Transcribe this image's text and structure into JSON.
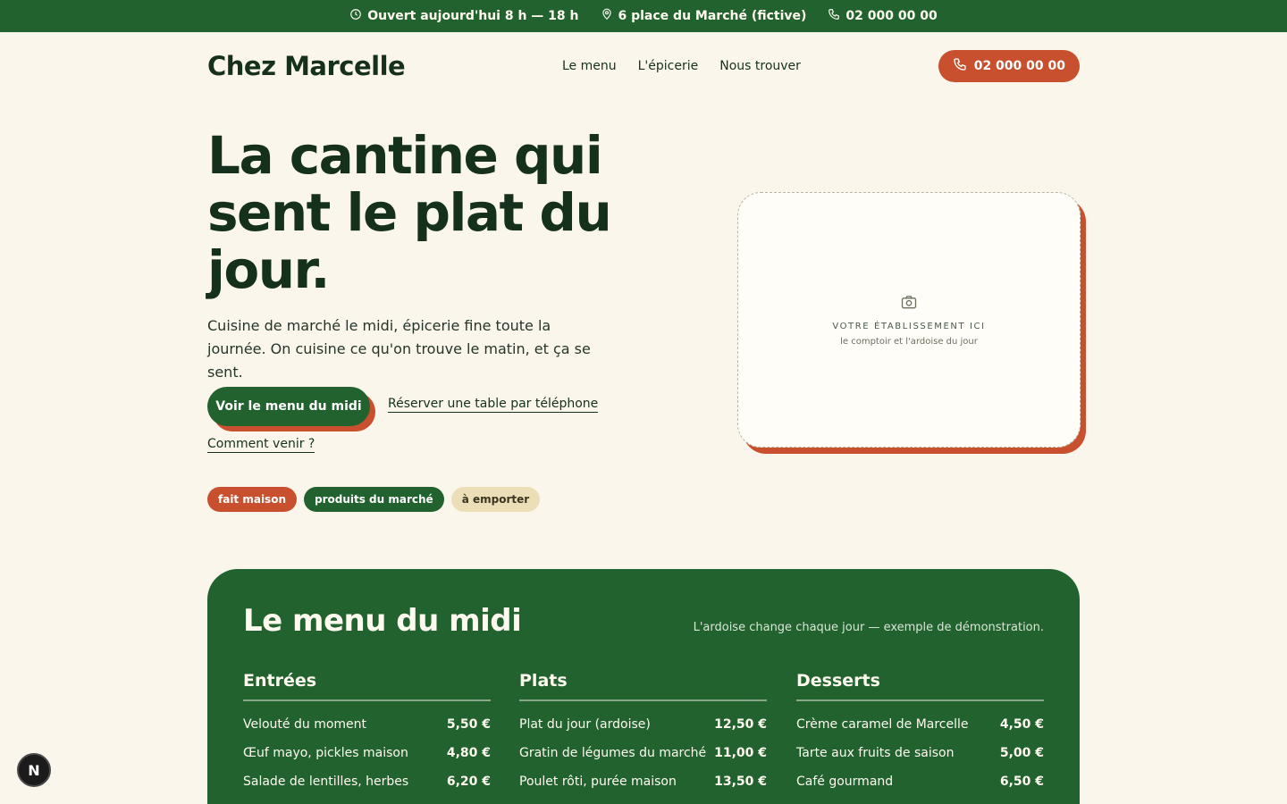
{
  "topbar": {
    "hours": "Ouvert aujourd'hui 8 h — 18 h",
    "address": "6 place du Marché (fictive)",
    "phone": "02 000 00 00"
  },
  "header": {
    "brand": "Chez Marcelle",
    "nav": [
      "Le menu",
      "L'épicerie",
      "Nous trouver"
    ],
    "call_label": "02 000 00 00"
  },
  "hero": {
    "title": "La cantine qui sent le plat du jour.",
    "lead": "Cuisine de marché le midi, épicerie fine toute la journée. On cuisine ce qu'on trouve le matin, et ça se sent.",
    "cta_primary": "Voir le menu du midi",
    "cta_reserve": "Réserver une table par téléphone",
    "cta_directions": "Comment venir ?",
    "tags": [
      "fait maison",
      "produits du marché",
      "à emporter"
    ]
  },
  "photo": {
    "title": "VOTRE ÉTABLISSEMENT ICI",
    "subtitle": "le comptoir et l'ardoise du jour"
  },
  "menu": {
    "title": "Le menu du midi",
    "note": "L'ardoise change chaque jour — exemple de démonstration.",
    "columns": [
      {
        "title": "Entrées",
        "items": [
          {
            "name": "Velouté du moment",
            "price": "5,50 €"
          },
          {
            "name": "Œuf mayo, pickles maison",
            "price": "4,80 €"
          },
          {
            "name": "Salade de lentilles, herbes",
            "price": "6,20 €"
          }
        ]
      },
      {
        "title": "Plats",
        "items": [
          {
            "name": "Plat du jour (ardoise)",
            "price": "12,50 €"
          },
          {
            "name": "Gratin de légumes du marché",
            "price": "11,00 €"
          },
          {
            "name": "Poulet rôti, purée maison",
            "price": "13,50 €"
          }
        ]
      },
      {
        "title": "Desserts",
        "items": [
          {
            "name": "Crème caramel de Marcelle",
            "price": "4,50 €"
          },
          {
            "name": "Tarte aux fruits de saison",
            "price": "5,00 €"
          },
          {
            "name": "Café gourmand",
            "price": "6,50 €"
          }
        ]
      }
    ]
  },
  "badge": {
    "letter": "N"
  },
  "colors": {
    "green": "#21622f",
    "terracotta": "#c8502e",
    "cream": "#faf6ec",
    "sand": "#ecdfb8"
  },
  "icons": [
    "clock-icon",
    "map-pin-icon",
    "phone-icon",
    "camera-icon"
  ]
}
